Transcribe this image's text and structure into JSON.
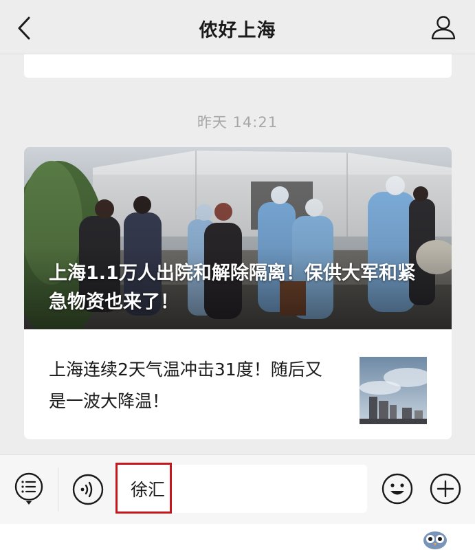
{
  "header": {
    "title": "侬好上海",
    "back_icon": "chevron-left-icon",
    "profile_icon": "person-icon"
  },
  "chat": {
    "timestamp": "昨天 14:21",
    "article": {
      "cover_title": "上海1.1万人出院和解除隔离！保供大军和紧急物资也来了！",
      "sub_title": "上海连续2天气温冲击31度！随后又是一波大降温！"
    }
  },
  "input_bar": {
    "menu_icon": "menu-list-icon",
    "voice_icon": "voice-icon",
    "input_value": "徐汇",
    "emoji_icon": "emoji-icon",
    "plus_icon": "plus-icon",
    "highlight_color": "#c8161d"
  },
  "colors": {
    "background": "#ededed",
    "card": "#ffffff",
    "timestamp": "#a7a7a7"
  }
}
